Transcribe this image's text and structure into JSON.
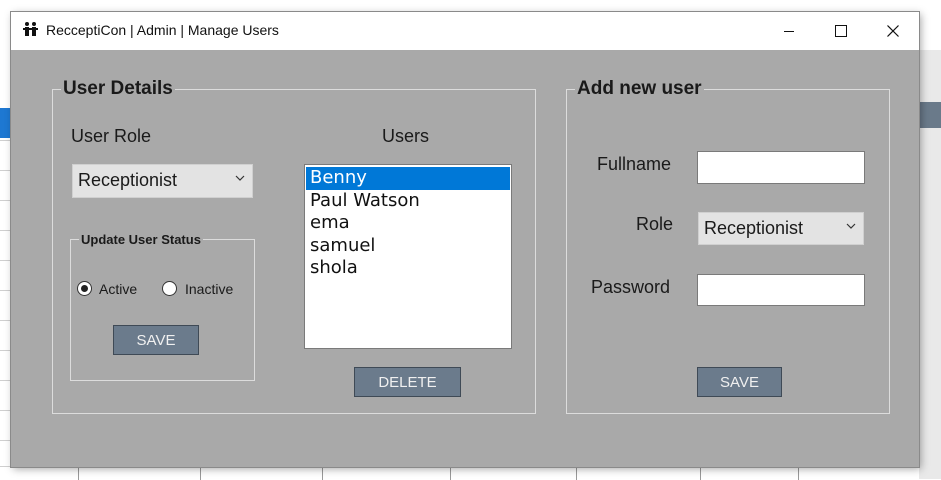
{
  "window": {
    "title": "RecceptiCon | Admin | Manage Users"
  },
  "user_details": {
    "legend": "User Details",
    "user_role_label": "User Role",
    "user_role_value": "Receptionist",
    "users_label": "Users",
    "users": [
      "Benny",
      "Paul Watson",
      "ema",
      "samuel",
      "shola"
    ],
    "selected_user": "Benny",
    "status_group": {
      "legend": "Update User Status",
      "active_label": "Active",
      "inactive_label": "Inactive",
      "selected": "Active",
      "save_label": "SAVE"
    },
    "delete_label": "DELETE"
  },
  "add_user": {
    "legend": "Add new user",
    "fullname_label": "Fullname",
    "fullname_value": "",
    "role_label": "Role",
    "role_value": "Receptionist",
    "password_label": "Password",
    "password_value": "",
    "save_label": "SAVE"
  },
  "icons": {
    "app": "users-icon",
    "minimize": "minimize-icon",
    "maximize": "maximize-icon",
    "close": "close-icon",
    "dropdown": "chevron-down-icon"
  },
  "colors": {
    "dialog_bg": "#a9a9a9",
    "button_bg": "#6b7b8c",
    "selection": "#0078d7"
  }
}
